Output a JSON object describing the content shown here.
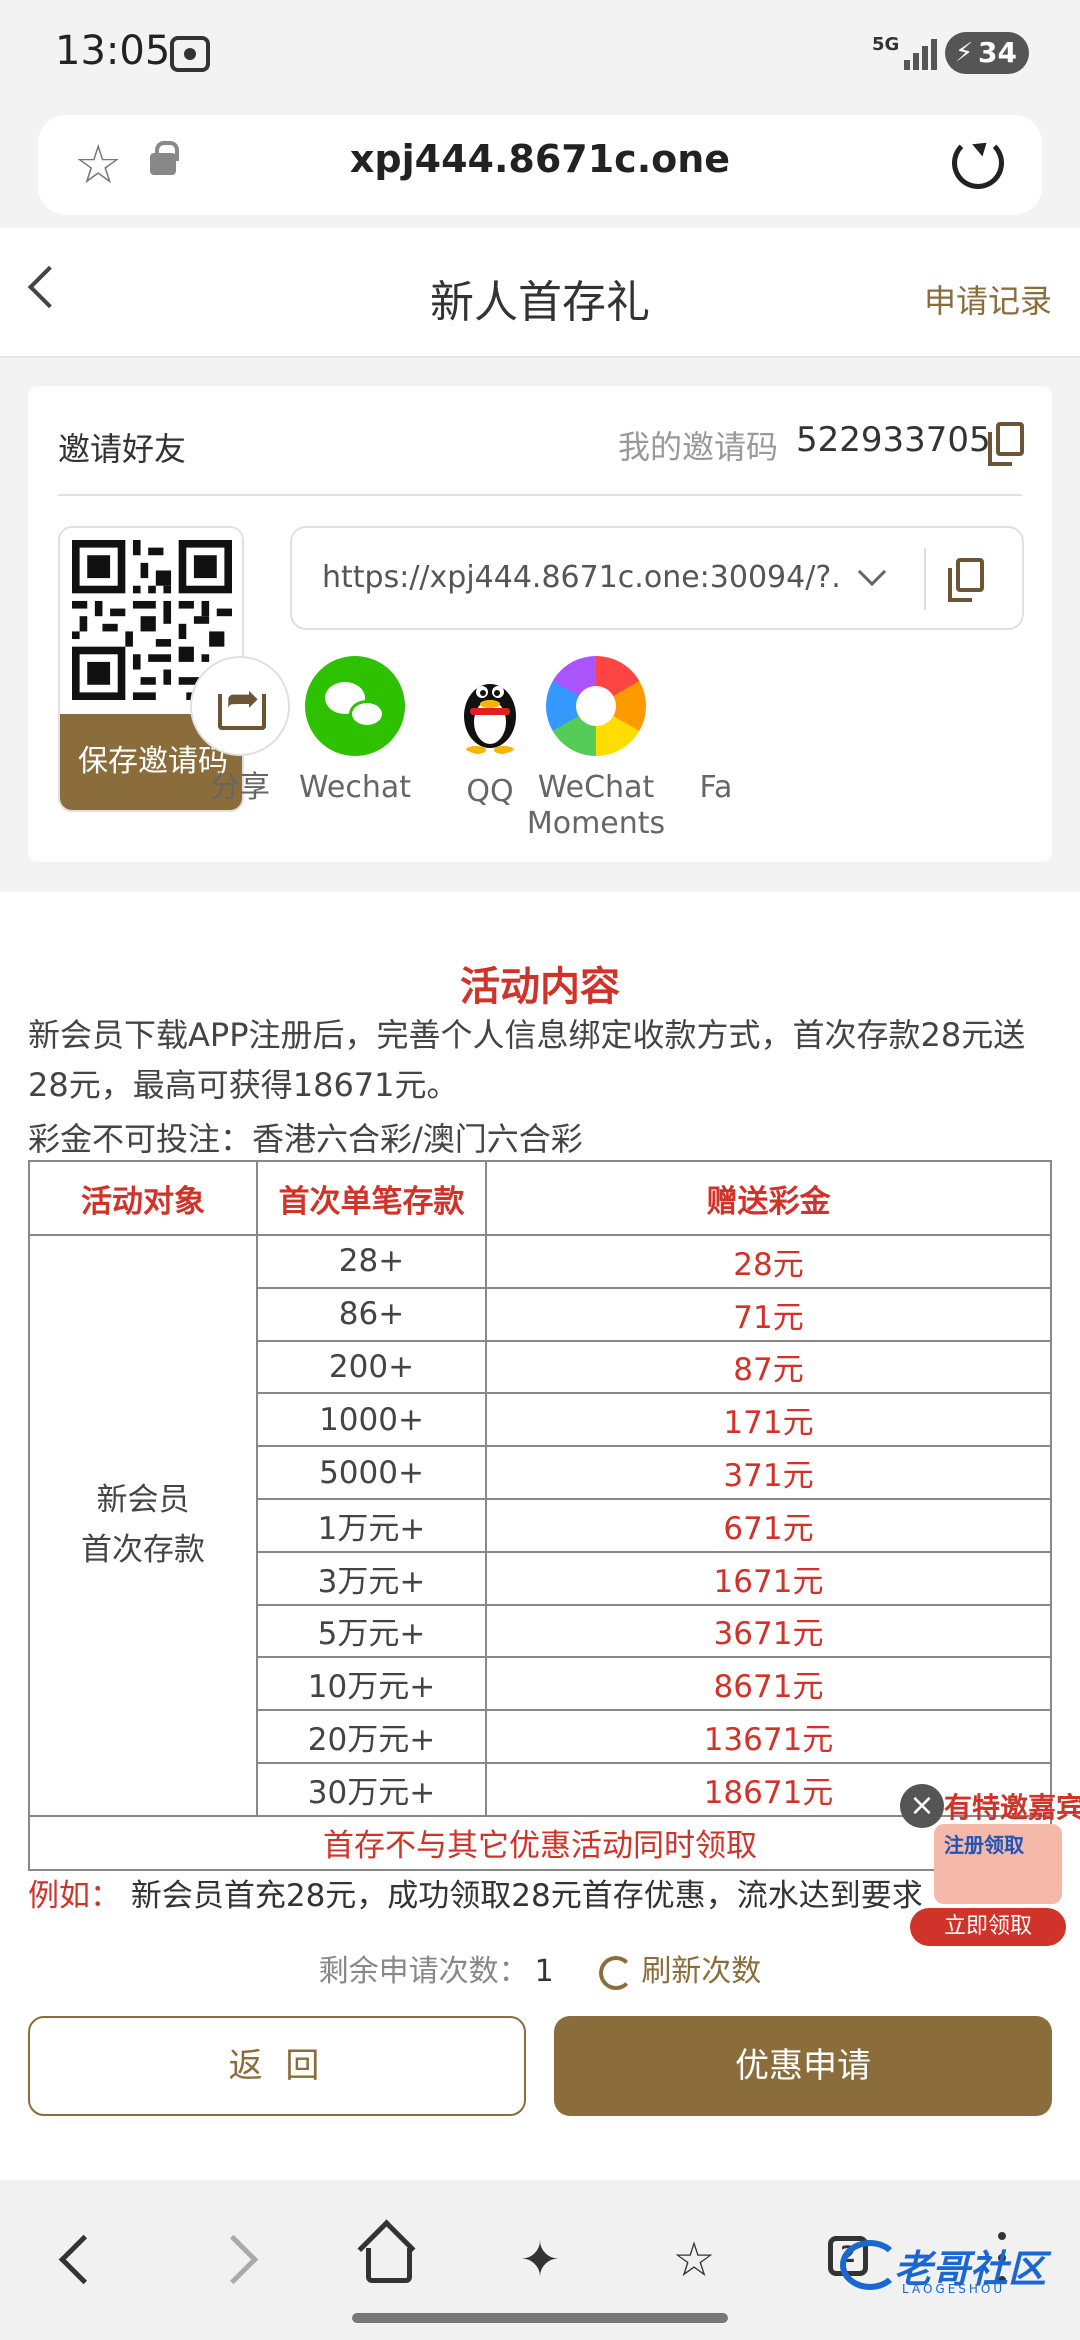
{
  "status_bar": {
    "time": "13:05",
    "network": "5G",
    "battery": "34"
  },
  "browser": {
    "url": "xpj444.8671c.one"
  },
  "header": {
    "title": "新人首存礼",
    "record_link": "申请记录"
  },
  "invite": {
    "title": "邀请好友",
    "code_label": "我的邀请码",
    "code": "522933705",
    "save_qr": "保存邀请码",
    "link": "https://xpj444.8671c.one:30094/?..."
  },
  "share": [
    {
      "label": "分享",
      "icon": "share-icon"
    },
    {
      "label": "Wechat",
      "icon": "wechat-icon"
    },
    {
      "label": "QQ",
      "icon": "qq-icon"
    },
    {
      "label": "WeChat Moments",
      "icon": "moments-icon"
    },
    {
      "label": "Fa",
      "icon": "facebook-icon"
    }
  ],
  "activity": {
    "title": "活动内容",
    "description": "新会员下载APP注册后，完善个人信息绑定收款方式，首次存款28元送28元，最高可获得18671元。",
    "note": "彩金不可投注：香港六合彩/澳门六合彩",
    "table": {
      "headers": [
        "活动对象",
        "首次单笔存款",
        "赠送彩金"
      ],
      "group_line1": "新会员",
      "group_line2": "首次存款",
      "rows": [
        {
          "deposit": "28+",
          "bonus": "28元"
        },
        {
          "deposit": "86+",
          "bonus": "71元"
        },
        {
          "deposit": "200+",
          "bonus": "87元"
        },
        {
          "deposit": "1000+",
          "bonus": "171元"
        },
        {
          "deposit": "5000+",
          "bonus": "371元"
        },
        {
          "deposit": "1万元+",
          "bonus": "671元"
        },
        {
          "deposit": "3万元+",
          "bonus": "1671元"
        },
        {
          "deposit": "5万元+",
          "bonus": "3671元"
        },
        {
          "deposit": "10万元+",
          "bonus": "8671元"
        },
        {
          "deposit": "20万元+",
          "bonus": "13671元"
        },
        {
          "deposit": "30万元+",
          "bonus": "18671元"
        }
      ],
      "footnote": "首存不与其它优惠活动同时领取"
    },
    "example_label": "例如：",
    "example_text": "新会员首充28元，成功领取28元首存优惠，流水达到要求"
  },
  "actions": {
    "remaining_label": "剩余申请次数：",
    "remaining_count": "1",
    "refresh_label": "刷新次数",
    "back_button": "返 回",
    "apply_button": "优惠申请"
  },
  "promo": {
    "headline": "有特邀嘉宾",
    "card_text": "注册领取",
    "cta": "立即领取",
    "close": "×"
  },
  "watermark": {
    "text": "老哥社区",
    "sub": "LAOGESHOU"
  },
  "colors": {
    "accent": "#8a6d3b",
    "highlight": "#d0332a",
    "wechat": "#2dc100"
  }
}
